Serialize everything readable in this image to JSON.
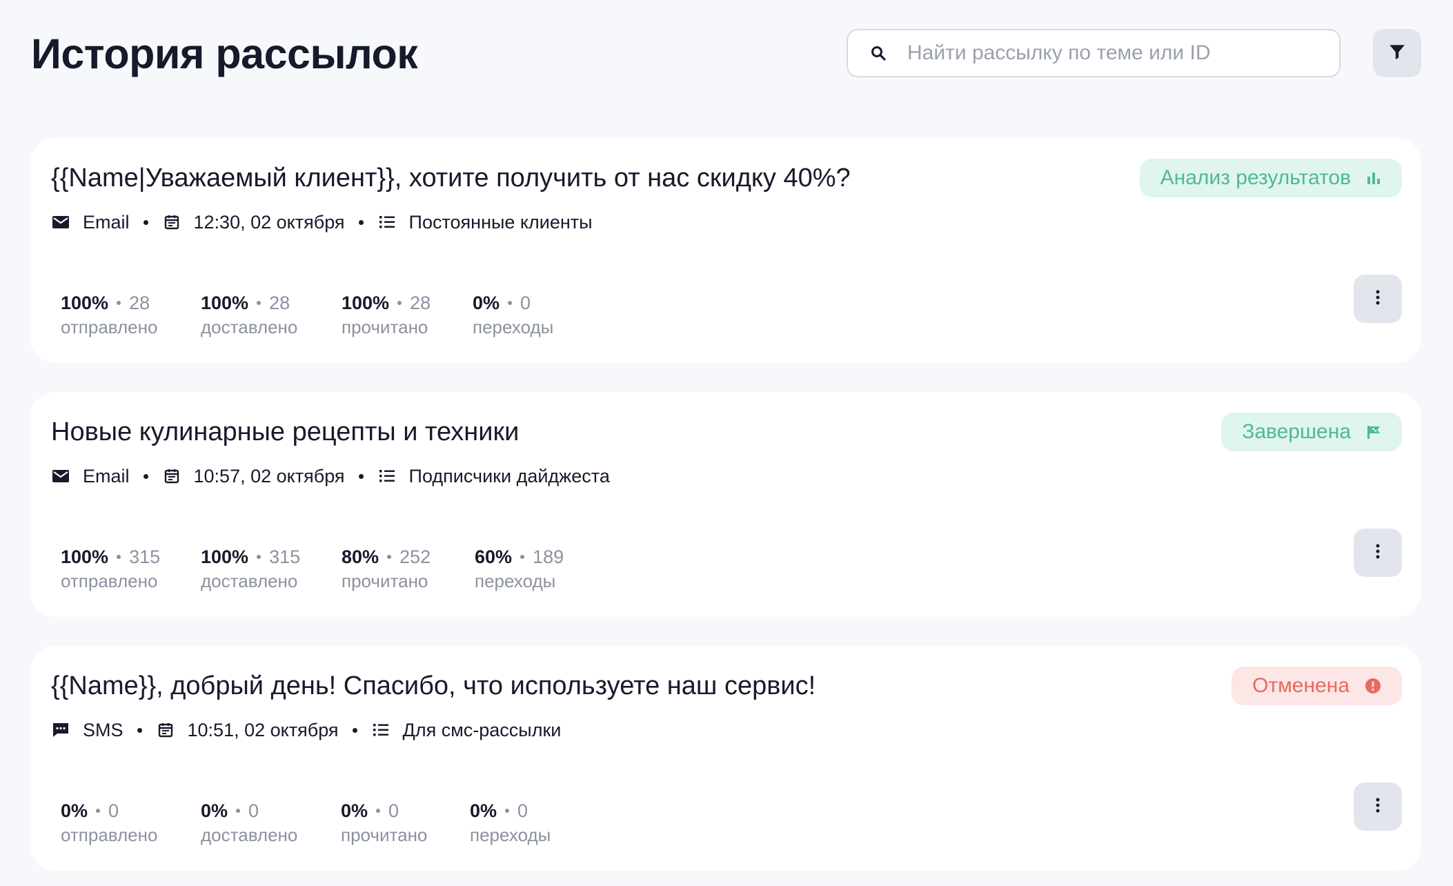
{
  "header": {
    "title": "История рассылок",
    "search_placeholder": "Найти рассылку по теме или ID",
    "search_value": ""
  },
  "colors": {
    "status_green": "#4fb89a",
    "status_green_bg": "#dff5ee",
    "status_red": "#e76b5f",
    "status_red_bg": "#fce6e6"
  },
  "campaigns": [
    {
      "title": "{{Name|Уважаемый клиент}}, хотите получить от нас скидку 40%?",
      "status": {
        "label": "Анализ результатов",
        "icon": "bar-chart-icon",
        "tone": "green"
      },
      "channel": {
        "label": "Email",
        "icon": "envelope-icon"
      },
      "datetime": "12:30, 02 октября",
      "segment": "Постоянные клиенты",
      "stats": [
        {
          "percent": "100%",
          "count": "28",
          "label": "отправлено"
        },
        {
          "percent": "100%",
          "count": "28",
          "label": "доставлено"
        },
        {
          "percent": "100%",
          "count": "28",
          "label": "прочитано"
        },
        {
          "percent": "0%",
          "count": "0",
          "label": "переходы"
        }
      ]
    },
    {
      "title": "Новые кулинарные рецепты и техники",
      "status": {
        "label": "Завершена",
        "icon": "flag-icon",
        "tone": "green"
      },
      "channel": {
        "label": "Email",
        "icon": "envelope-icon"
      },
      "datetime": "10:57, 02 октября",
      "segment": "Подписчики дайджеста",
      "stats": [
        {
          "percent": "100%",
          "count": "315",
          "label": "отправлено"
        },
        {
          "percent": "100%",
          "count": "315",
          "label": "доставлено"
        },
        {
          "percent": "80%",
          "count": "252",
          "label": "прочитано"
        },
        {
          "percent": "60%",
          "count": "189",
          "label": "переходы"
        }
      ]
    },
    {
      "title": "{{Name}}, добрый день! Спасибо, что используете наш сервис!",
      "status": {
        "label": "Отменена",
        "icon": "alert-circle-icon",
        "tone": "red"
      },
      "channel": {
        "label": "SMS",
        "icon": "chat-bubble-icon"
      },
      "datetime": "10:51, 02 октября",
      "segment": "Для смс-рассылки",
      "stats": [
        {
          "percent": "0%",
          "count": "0",
          "label": "отправлено"
        },
        {
          "percent": "0%",
          "count": "0",
          "label": "доставлено"
        },
        {
          "percent": "0%",
          "count": "0",
          "label": "прочитано"
        },
        {
          "percent": "0%",
          "count": "0",
          "label": "переходы"
        }
      ]
    }
  ]
}
